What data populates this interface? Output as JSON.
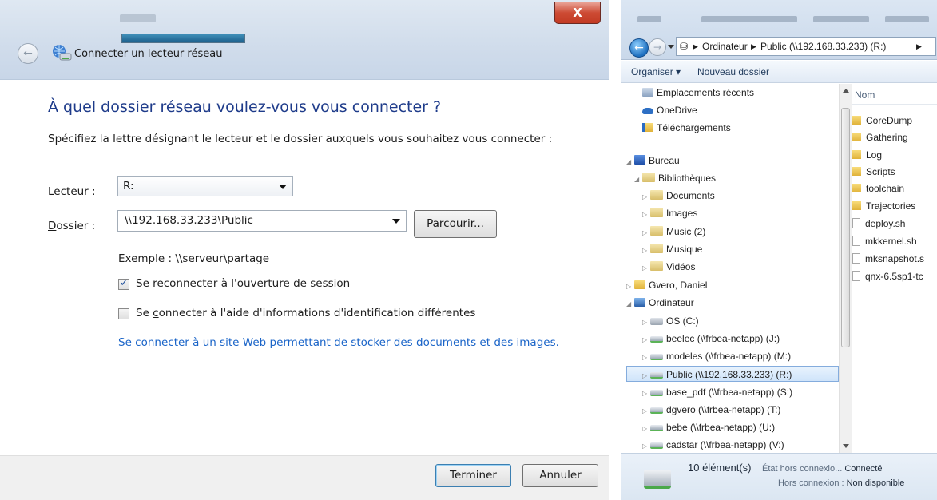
{
  "dialog": {
    "title": "Connecter un lecteur réseau",
    "close_label": "X",
    "heading": "À quel dossier réseau voulez-vous vous connecter ?",
    "instruction": "Spécifiez la lettre désignant le lecteur et le dossier auxquels vous souhaitez vous connecter :",
    "drive": {
      "label_accel": "L",
      "label_rest": "ecteur :",
      "value": "R:"
    },
    "folder": {
      "label_accel": "D",
      "label_rest": "ossier :",
      "value": "\\\\192.168.33.233\\Public",
      "browse_pre": "P",
      "browse_accel": "a",
      "browse_post": "rcourir..."
    },
    "example": "Exemple : \\\\serveur\\partage",
    "reconnect": {
      "pre": "Se ",
      "accel": "r",
      "post": "econnecter à l'ouverture de session",
      "checked": true
    },
    "other_creds": {
      "pre": "Se ",
      "accel": "c",
      "post": "onnecter à l'aide d'informations d'identification différentes",
      "checked": false
    },
    "web_link": "Se connecter à un site Web permettant de stocker des documents et des images.",
    "finish_label": "Terminer",
    "cancel_label": "Annuler"
  },
  "explorer": {
    "address": {
      "seg1": "Ordinateur",
      "seg2": "Public (\\\\192.168.33.233) (R:)"
    },
    "commands": {
      "organize": "Organiser ▾",
      "new_folder": "Nouveau dossier"
    },
    "nav": [
      {
        "label": "Emplacements récents",
        "icon": "recent-icon"
      },
      {
        "label": "OneDrive",
        "icon": "cloud-icon"
      },
      {
        "label": "Téléchargements",
        "icon": "downloads-icon"
      },
      {
        "label": "Bureau",
        "icon": "desktop-icon"
      },
      {
        "label": "Bibliothèques",
        "icon": "library-icon"
      },
      {
        "label": "Documents",
        "icon": "library-icon"
      },
      {
        "label": "Images",
        "icon": "library-icon"
      },
      {
        "label": "Music (2)",
        "icon": "library-icon"
      },
      {
        "label": "Musique",
        "icon": "library-icon"
      },
      {
        "label": "Vidéos",
        "icon": "library-icon"
      },
      {
        "label": "Gvero, Daniel",
        "icon": "folder-icon"
      },
      {
        "label": "Ordinateur",
        "icon": "computer-icon"
      },
      {
        "label": "OS (C:)",
        "icon": "drive-icon"
      },
      {
        "label": "beelec (\\\\frbea-netapp) (J:)",
        "icon": "network-drive-icon"
      },
      {
        "label": "modeles (\\\\frbea-netapp) (M:)",
        "icon": "network-drive-icon"
      },
      {
        "label": "Public (\\\\192.168.33.233) (R:)",
        "icon": "network-drive-icon"
      },
      {
        "label": "base_pdf (\\\\frbea-netapp) (S:)",
        "icon": "network-drive-icon"
      },
      {
        "label": "dgvero (\\\\frbea-netapp) (T:)",
        "icon": "network-drive-icon"
      },
      {
        "label": "bebe (\\\\frbea-netapp) (U:)",
        "icon": "network-drive-icon"
      },
      {
        "label": "cadstar (\\\\frbea-netapp) (V:)",
        "icon": "network-drive-icon"
      }
    ],
    "files_header": "Nom",
    "files": [
      {
        "name": "CoreDump",
        "type": "folder"
      },
      {
        "name": "Gathering",
        "type": "folder"
      },
      {
        "name": "Log",
        "type": "folder"
      },
      {
        "name": "Scripts",
        "type": "folder"
      },
      {
        "name": "toolchain",
        "type": "folder"
      },
      {
        "name": "Trajectories",
        "type": "folder"
      },
      {
        "name": "deploy.sh",
        "type": "doc"
      },
      {
        "name": "mkkernel.sh",
        "type": "doc"
      },
      {
        "name": "mksnapshot.s",
        "type": "doc"
      },
      {
        "name": "qnx-6.5sp1-tc",
        "type": "doc"
      }
    ],
    "status": {
      "count": "10 élément(s)",
      "state_label": "État hors connexio...",
      "state_value": "Connecté",
      "offline_label": "Hors connexion :",
      "offline_value": "Non disponible"
    }
  },
  "colors": {
    "accent_link": "#1a64c8",
    "heading_blue": "#1e3b8a",
    "close_red": "#c23a23"
  }
}
